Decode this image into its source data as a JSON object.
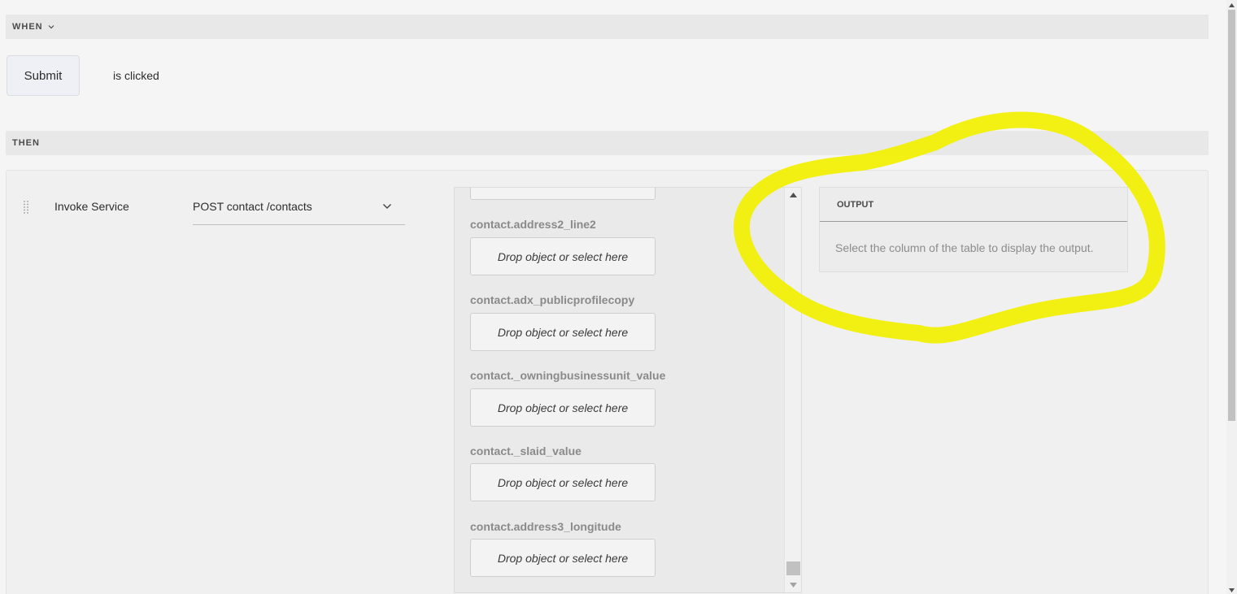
{
  "when": {
    "header_label": "WHEN",
    "button_label": "Submit",
    "event_text": "is clicked"
  },
  "then": {
    "header_label": "THEN",
    "action_label": "Invoke Service",
    "service_value": "POST contact /contacts"
  },
  "fields": [
    {
      "label": "contact.address2_line2",
      "placeholder": "Drop object or select here"
    },
    {
      "label": "contact.adx_publicprofilecopy",
      "placeholder": "Drop object or select here"
    },
    {
      "label": "contact._owningbusinessunit_value",
      "placeholder": "Drop object or select here"
    },
    {
      "label": "contact._slaid_value",
      "placeholder": "Drop object or select here"
    },
    {
      "label": "contact.address3_longitude",
      "placeholder": "Drop object or select here"
    }
  ],
  "output": {
    "title": "OUTPUT",
    "message": "Select the column of the table to display the output."
  },
  "colors": {
    "annotation": "#f2f000",
    "background": "#f5f5f5"
  },
  "icons": {
    "when_toggle": "chevron-down-icon",
    "service_dropdown": "chevron-down-icon",
    "drag": "drag-handle-icon"
  }
}
